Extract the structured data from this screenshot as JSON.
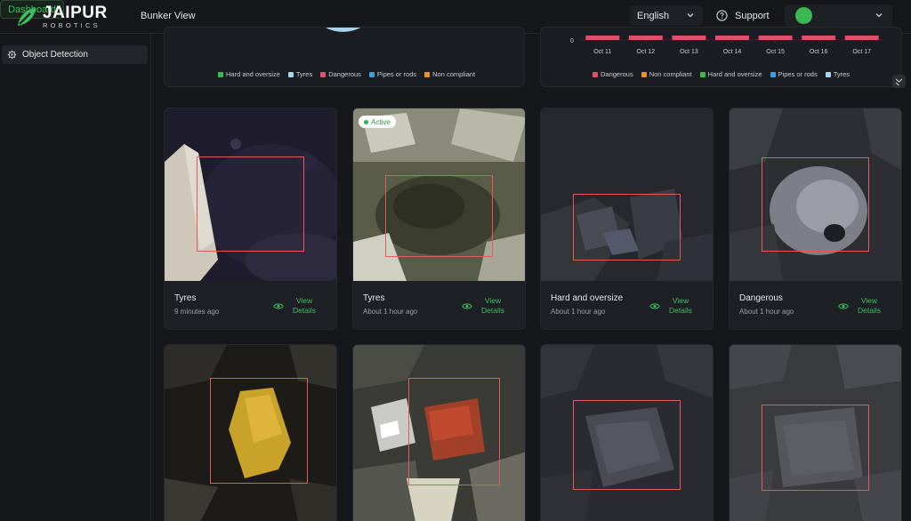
{
  "brand": {
    "name": "JAIPUR",
    "subtitle": "ROBOTICS",
    "accent": "#3bbf5e"
  },
  "nav": {
    "bunker": "Bunker View",
    "dashboard": "Dashboard"
  },
  "header": {
    "language": "English",
    "support": "Support"
  },
  "sidebar": {
    "items": [
      {
        "label": "Object Detection",
        "icon": "gear-icon"
      }
    ]
  },
  "pie_legend": [
    {
      "label": "Hard and oversize",
      "color": "#3ab852"
    },
    {
      "label": "Tyres",
      "color": "#a8d4f0"
    },
    {
      "label": "Dangerous",
      "color": "#e0506a"
    },
    {
      "label": "Pipes or rods",
      "color": "#3aa0e0"
    },
    {
      "label": "Non compliant",
      "color": "#f0902a"
    }
  ],
  "bar_legend": [
    {
      "label": "Dangerous",
      "color": "#e0506a"
    },
    {
      "label": "Non compliant",
      "color": "#f0902a"
    },
    {
      "label": "Hard and oversize",
      "color": "#3ab852"
    },
    {
      "label": "Pipes or rods",
      "color": "#3aa0e0"
    },
    {
      "label": "Tyres",
      "color": "#a8d4f0"
    }
  ],
  "chart_data": [
    {
      "type": "pie",
      "title": "",
      "legend": [
        "Hard and oversize",
        "Tyres",
        "Dangerous",
        "Pipes or rods",
        "Non compliant"
      ],
      "legend_placement": "bottom"
    },
    {
      "type": "bar",
      "title": "",
      "categories": [
        "Oct 11",
        "Oct 12",
        "Oct 13",
        "Oct 14",
        "Oct 15",
        "Oct 16",
        "Oct 17"
      ],
      "y_ticks": [
        "0"
      ],
      "legend": [
        "Dangerous",
        "Non compliant",
        "Hard and oversize",
        "Pipes or rods",
        "Tyres"
      ],
      "legend_placement": "bottom"
    }
  ],
  "cards": [
    {
      "title": "Tyres",
      "time": "9 minutes ago",
      "view": "View Details"
    },
    {
      "title": "Tyres",
      "time": "About 1 hour ago",
      "view": "View Details",
      "badge": "Active"
    },
    {
      "title": "Hard and oversize",
      "time": "About 1 hour ago",
      "view": "View Details"
    },
    {
      "title": "Dangerous",
      "time": "About 1 hour ago",
      "view": "View Details"
    }
  ]
}
